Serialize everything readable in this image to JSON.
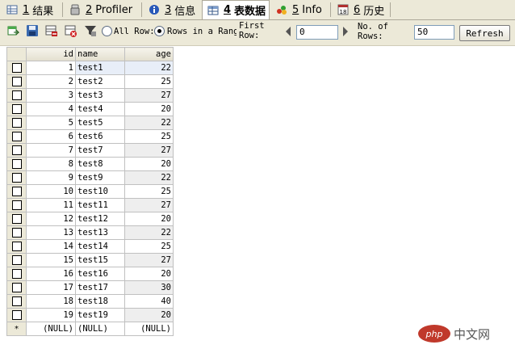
{
  "tabs": [
    {
      "num": "1",
      "label": "结果",
      "icon": "results-grid-icon",
      "active": false
    },
    {
      "num": "2",
      "label": "Profiler",
      "icon": "profiler-icon",
      "active": false
    },
    {
      "num": "3",
      "label": "信息",
      "icon": "info-icon",
      "active": false
    },
    {
      "num": "4",
      "label": "表数据",
      "icon": "table-data-icon",
      "active": true
    },
    {
      "num": "5",
      "label": "Info",
      "icon": "table-info-icon",
      "active": false
    },
    {
      "num": "6",
      "label": "历史",
      "icon": "history-calendar-icon",
      "active": false
    }
  ],
  "history_icon_date": "18",
  "toolbar": {
    "buttons": [
      "export-icon",
      "save-icon",
      "delete-row-icon",
      "cancel-icon",
      "filter-icon"
    ],
    "all_rows_label": "All Row:",
    "rows_in_range_label": "Rows in a Rang",
    "selected_mode": "rows_in_range",
    "first_row_label": "First Row:",
    "first_row_value": "0",
    "no_of_rows_label": "No. of Rows:",
    "no_of_rows_value": "50",
    "refresh_label": "Refresh"
  },
  "grid": {
    "columns": [
      "id",
      "name",
      "age"
    ],
    "rows": [
      [
        "1",
        "test1",
        "22"
      ],
      [
        "2",
        "test2",
        "25"
      ],
      [
        "3",
        "test3",
        "27"
      ],
      [
        "4",
        "test4",
        "20"
      ],
      [
        "5",
        "test5",
        "22"
      ],
      [
        "6",
        "test6",
        "25"
      ],
      [
        "7",
        "test7",
        "27"
      ],
      [
        "8",
        "test8",
        "20"
      ],
      [
        "9",
        "test9",
        "22"
      ],
      [
        "10",
        "test10",
        "25"
      ],
      [
        "11",
        "test11",
        "27"
      ],
      [
        "12",
        "test12",
        "20"
      ],
      [
        "13",
        "test13",
        "22"
      ],
      [
        "14",
        "test14",
        "25"
      ],
      [
        "15",
        "test15",
        "27"
      ],
      [
        "16",
        "test16",
        "20"
      ],
      [
        "17",
        "test17",
        "30"
      ],
      [
        "18",
        "test18",
        "40"
      ],
      [
        "19",
        "test19",
        "20"
      ]
    ],
    "new_row_marker": "*",
    "new_row_values": [
      "(NULL)",
      "(NULL)",
      "(NULL)"
    ]
  },
  "watermark": {
    "text": "中文网",
    "badge": "php"
  }
}
